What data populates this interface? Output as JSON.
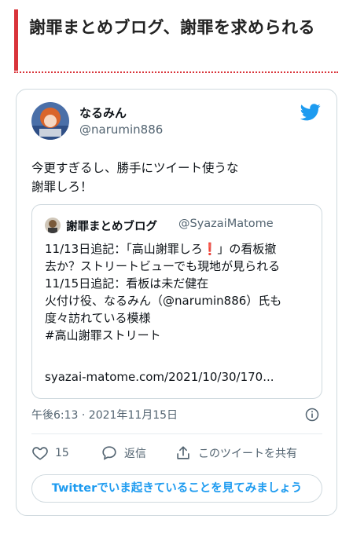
{
  "article": {
    "title": "謝罪まとめブログ、謝罪を求められる"
  },
  "tweet": {
    "author_name": "なるみん",
    "author_handle": "@narumin886",
    "text": "今更すぎるし、勝手にツイート使うな\n謝罪しろ！",
    "timestamp": "午後6:13 · 2021年11月15日",
    "like_count": "15",
    "reply_label": "返信",
    "share_label": "このツイートを共有",
    "cta_label": "Twitterでいま起きていることを見てみましょう"
  },
  "quoted_tweet": {
    "author_name": "謝罪まとめブログ",
    "author_handle": "@SyazaiMatome",
    "text": "11/13日追記：「高山謝罪しろ❗」の看板撤\n去か？ストリートビューでも現地が見られる\n11/15日追記：看板は未だ健在\n火付け役、なるみん（@narumin886）氏も\n度々訪れている模様\n#高山謝罪ストリート",
    "link": "syazai-matome.com/2021/10/30/170..."
  },
  "icons": {
    "brand": "twitter-bird-icon",
    "info": "info-icon",
    "like": "heart-icon",
    "reply": "speech-bubble-icon",
    "share": "share-icon"
  },
  "colors": {
    "accent_red": "#d9343a",
    "twitter_blue": "#1d9bf0",
    "muted": "#536471"
  }
}
